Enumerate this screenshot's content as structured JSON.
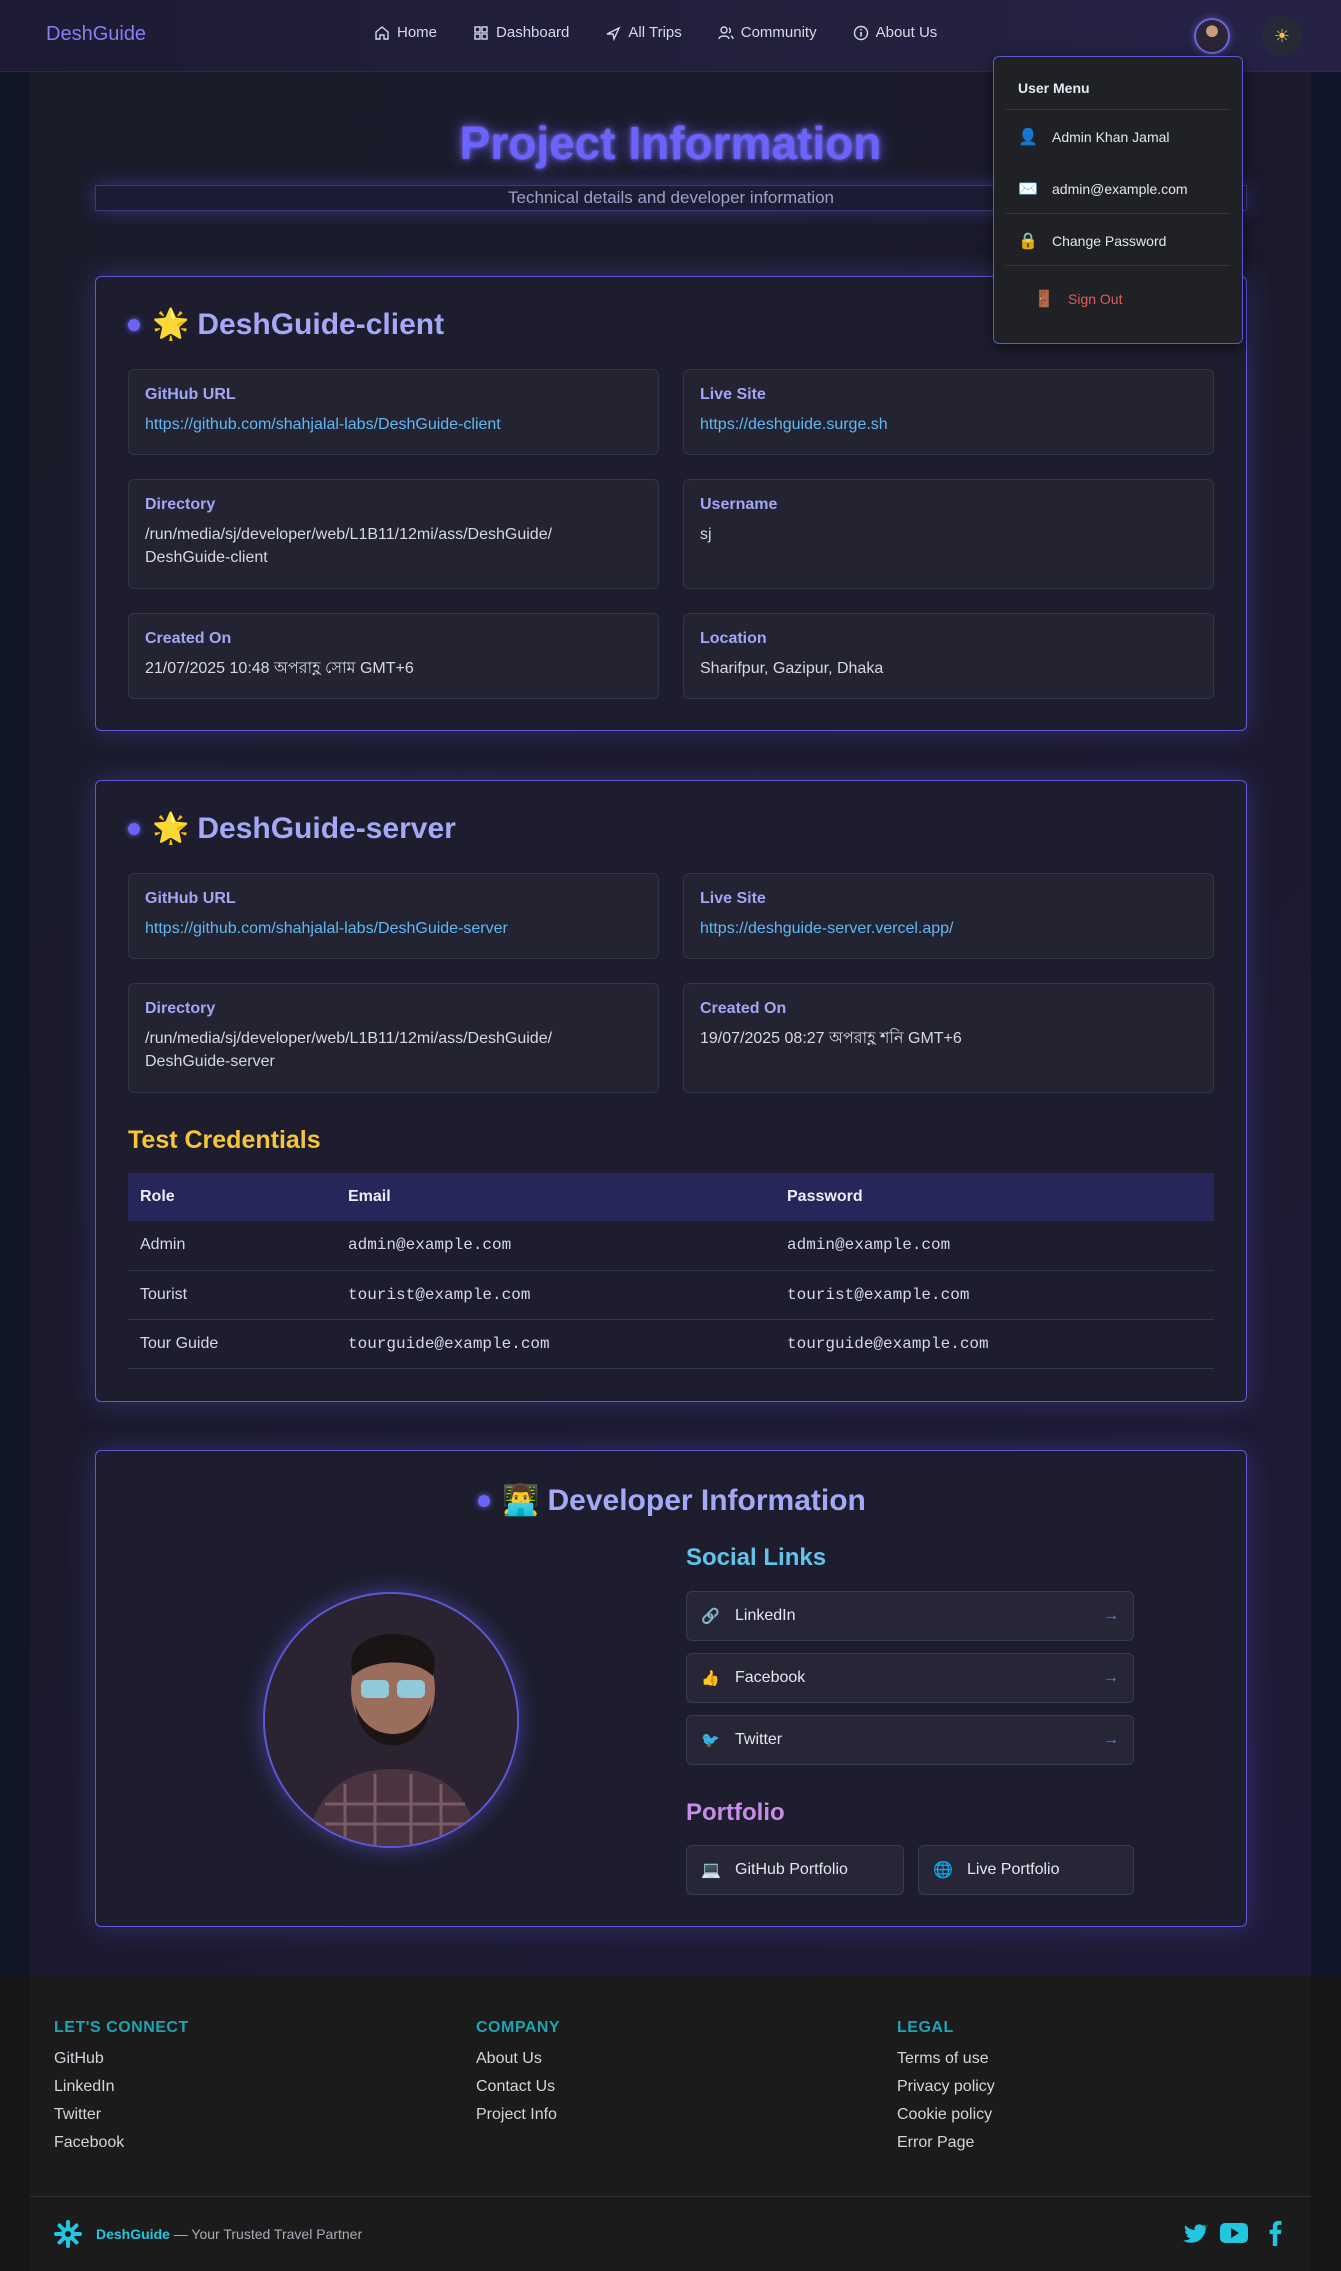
{
  "nav": {
    "brand": "DeshGuide",
    "links": [
      "Home",
      "Dashboard",
      "All Trips",
      "Community",
      "About Us"
    ]
  },
  "page": {
    "title": "Project Information",
    "subtitle": "Technical details and developer information"
  },
  "client": {
    "title": "DeshGuide-client",
    "emoji": "🌟",
    "github_label": "GitHub URL",
    "github_value": "https://github.com/shahjalal-labs/DeshGuide-client",
    "live_label": "Live Site",
    "live_value": "https://deshguide.surge.sh",
    "dir_label": "Directory",
    "dir_value_1": "/run/media/sj/developer/web/L1B11/12mi/ass/DeshGuide/",
    "dir_value_2": "DeshGuide-client",
    "user_label": "Username",
    "user_value": "sj",
    "created_label": "Created On",
    "created_value": "21/07/2025 10:48 অপরাহ্ণ সোম GMT+6",
    "loc_label": "Location",
    "loc_value": "Sharifpur, Gazipur, Dhaka"
  },
  "server": {
    "title": "DeshGuide-server",
    "emoji": "🌟",
    "github_label": "GitHub URL",
    "github_value": "https://github.com/shahjalal-labs/DeshGuide-server",
    "live_label": "Live Site",
    "live_value": "https://deshguide-server.vercel.app/",
    "dir_label": "Directory",
    "dir_value_1": "/run/media/sj/developer/web/L1B11/12mi/ass/DeshGuide/",
    "dir_value_2": "DeshGuide-server",
    "created_label": "Created On",
    "created_value": "19/07/2025 08:27 অপরাহ্ণ শনি GMT+6",
    "cred_title": "Test Credentials",
    "cred_headers": [
      "Role",
      "Email",
      "Password"
    ],
    "cred_rows": [
      [
        "Admin",
        "admin@example.com",
        "admin@example.com"
      ],
      [
        "Tourist",
        "tourist@example.com",
        "tourist@example.com"
      ],
      [
        "Tour Guide",
        "tourguide@example.com",
        "tourguide@example.com"
      ]
    ]
  },
  "developer": {
    "title": "Developer Information",
    "emoji": "👨‍💻",
    "social_title": "Social Links",
    "social": [
      "LinkedIn",
      "Facebook",
      "Twitter"
    ],
    "portfolio_title": "Portfolio",
    "portfolio": [
      "GitHub Portfolio",
      "Live Portfolio"
    ]
  },
  "user_menu": {
    "header": "User Menu",
    "name": "Admin Khan Jamal",
    "email": "admin@example.com",
    "change_password": "Change Password",
    "sign_out": "Sign Out"
  },
  "footer": {
    "col1_title": "LET'S CONNECT",
    "col1": [
      "GitHub",
      "LinkedIn",
      "Twitter",
      "Facebook"
    ],
    "col2_title": "COMPANY",
    "col2": [
      "About Us",
      "Contact Us",
      "Project Info"
    ],
    "col3_title": "LEGAL",
    "col3": [
      "Terms of use",
      "Privacy policy",
      "Cookie policy",
      "Error Page"
    ],
    "brand": "DeshGuide",
    "tagline": " — Your Trusted Travel Partner"
  },
  "colors": {
    "accent": "#6c63ff",
    "link": "#5fb8f4",
    "gold": "#f5c53b",
    "teal": "#1fa4b5"
  }
}
